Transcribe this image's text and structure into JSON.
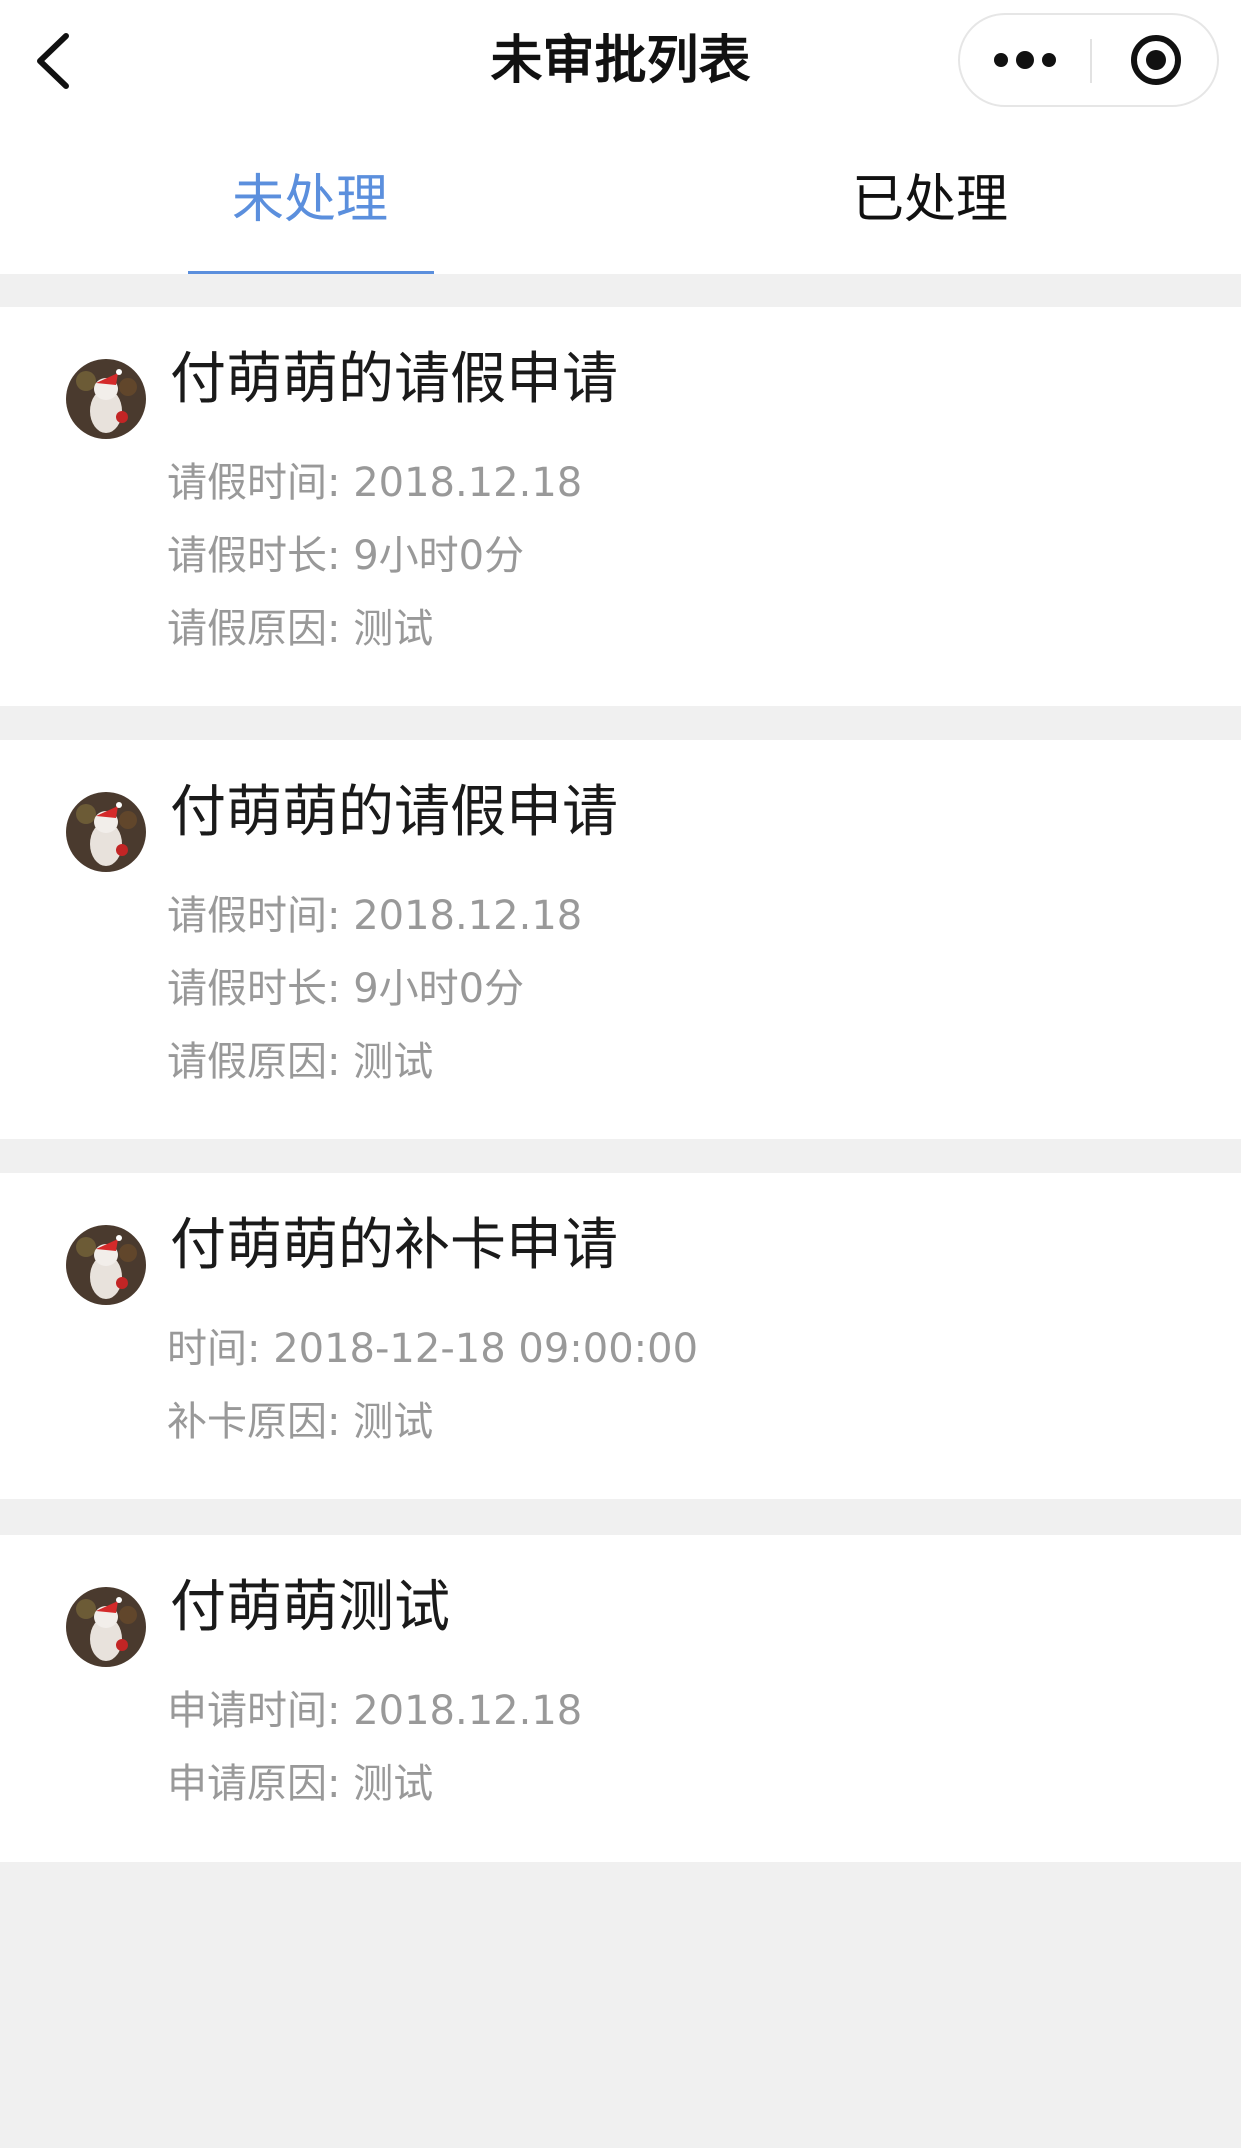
{
  "nav": {
    "title": "未审批列表",
    "back_icon": "chevron-left-icon",
    "more_icon": "more-dots-icon",
    "close_icon": "target-circle-icon"
  },
  "tabs": [
    {
      "label": "未处理",
      "active": true
    },
    {
      "label": "已处理",
      "active": false
    }
  ],
  "colors": {
    "accent": "#5b8fdd",
    "title_text": "#1a1a1a",
    "detail_text": "#999999",
    "page_bg": "#f0f0f0"
  },
  "cards": [
    {
      "title": "付萌萌的请假申请",
      "lines": [
        {
          "label": "请假时间:",
          "value": "2018.12.18"
        },
        {
          "label": "请假时长:",
          "value": "9小时0分"
        },
        {
          "label": "请假原因:",
          "value": "测试"
        }
      ]
    },
    {
      "title": "付萌萌的请假申请",
      "lines": [
        {
          "label": "请假时间:",
          "value": "2018.12.18"
        },
        {
          "label": "请假时长:",
          "value": "9小时0分"
        },
        {
          "label": "请假原因:",
          "value": "测试"
        }
      ]
    },
    {
      "title": "付萌萌的补卡申请",
      "lines": [
        {
          "label": "时间:",
          "value": "2018-12-18 09:00:00"
        },
        {
          "label": "补卡原因:",
          "value": "测试"
        }
      ]
    },
    {
      "title": "付萌萌测试",
      "lines": [
        {
          "label": "申请时间:",
          "value": "2018.12.18"
        },
        {
          "label": "申请原因:",
          "value": "测试"
        }
      ]
    }
  ]
}
